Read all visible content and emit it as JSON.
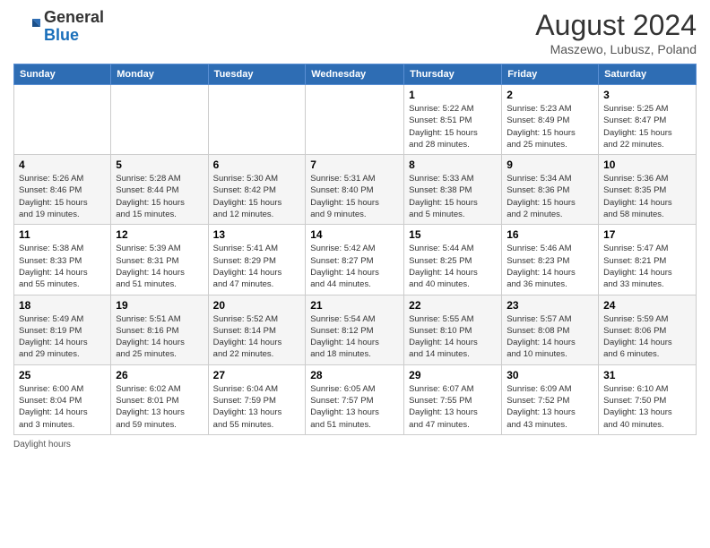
{
  "header": {
    "logo_general": "General",
    "logo_blue": "Blue",
    "month_year": "August 2024",
    "location": "Maszewo, Lubusz, Poland"
  },
  "days_of_week": [
    "Sunday",
    "Monday",
    "Tuesday",
    "Wednesday",
    "Thursday",
    "Friday",
    "Saturday"
  ],
  "weeks": [
    [
      {
        "num": "",
        "info": ""
      },
      {
        "num": "",
        "info": ""
      },
      {
        "num": "",
        "info": ""
      },
      {
        "num": "",
        "info": ""
      },
      {
        "num": "1",
        "info": "Sunrise: 5:22 AM\nSunset: 8:51 PM\nDaylight: 15 hours\nand 28 minutes."
      },
      {
        "num": "2",
        "info": "Sunrise: 5:23 AM\nSunset: 8:49 PM\nDaylight: 15 hours\nand 25 minutes."
      },
      {
        "num": "3",
        "info": "Sunrise: 5:25 AM\nSunset: 8:47 PM\nDaylight: 15 hours\nand 22 minutes."
      }
    ],
    [
      {
        "num": "4",
        "info": "Sunrise: 5:26 AM\nSunset: 8:46 PM\nDaylight: 15 hours\nand 19 minutes."
      },
      {
        "num": "5",
        "info": "Sunrise: 5:28 AM\nSunset: 8:44 PM\nDaylight: 15 hours\nand 15 minutes."
      },
      {
        "num": "6",
        "info": "Sunrise: 5:30 AM\nSunset: 8:42 PM\nDaylight: 15 hours\nand 12 minutes."
      },
      {
        "num": "7",
        "info": "Sunrise: 5:31 AM\nSunset: 8:40 PM\nDaylight: 15 hours\nand 9 minutes."
      },
      {
        "num": "8",
        "info": "Sunrise: 5:33 AM\nSunset: 8:38 PM\nDaylight: 15 hours\nand 5 minutes."
      },
      {
        "num": "9",
        "info": "Sunrise: 5:34 AM\nSunset: 8:36 PM\nDaylight: 15 hours\nand 2 minutes."
      },
      {
        "num": "10",
        "info": "Sunrise: 5:36 AM\nSunset: 8:35 PM\nDaylight: 14 hours\nand 58 minutes."
      }
    ],
    [
      {
        "num": "11",
        "info": "Sunrise: 5:38 AM\nSunset: 8:33 PM\nDaylight: 14 hours\nand 55 minutes."
      },
      {
        "num": "12",
        "info": "Sunrise: 5:39 AM\nSunset: 8:31 PM\nDaylight: 14 hours\nand 51 minutes."
      },
      {
        "num": "13",
        "info": "Sunrise: 5:41 AM\nSunset: 8:29 PM\nDaylight: 14 hours\nand 47 minutes."
      },
      {
        "num": "14",
        "info": "Sunrise: 5:42 AM\nSunset: 8:27 PM\nDaylight: 14 hours\nand 44 minutes."
      },
      {
        "num": "15",
        "info": "Sunrise: 5:44 AM\nSunset: 8:25 PM\nDaylight: 14 hours\nand 40 minutes."
      },
      {
        "num": "16",
        "info": "Sunrise: 5:46 AM\nSunset: 8:23 PM\nDaylight: 14 hours\nand 36 minutes."
      },
      {
        "num": "17",
        "info": "Sunrise: 5:47 AM\nSunset: 8:21 PM\nDaylight: 14 hours\nand 33 minutes."
      }
    ],
    [
      {
        "num": "18",
        "info": "Sunrise: 5:49 AM\nSunset: 8:19 PM\nDaylight: 14 hours\nand 29 minutes."
      },
      {
        "num": "19",
        "info": "Sunrise: 5:51 AM\nSunset: 8:16 PM\nDaylight: 14 hours\nand 25 minutes."
      },
      {
        "num": "20",
        "info": "Sunrise: 5:52 AM\nSunset: 8:14 PM\nDaylight: 14 hours\nand 22 minutes."
      },
      {
        "num": "21",
        "info": "Sunrise: 5:54 AM\nSunset: 8:12 PM\nDaylight: 14 hours\nand 18 minutes."
      },
      {
        "num": "22",
        "info": "Sunrise: 5:55 AM\nSunset: 8:10 PM\nDaylight: 14 hours\nand 14 minutes."
      },
      {
        "num": "23",
        "info": "Sunrise: 5:57 AM\nSunset: 8:08 PM\nDaylight: 14 hours\nand 10 minutes."
      },
      {
        "num": "24",
        "info": "Sunrise: 5:59 AM\nSunset: 8:06 PM\nDaylight: 14 hours\nand 6 minutes."
      }
    ],
    [
      {
        "num": "25",
        "info": "Sunrise: 6:00 AM\nSunset: 8:04 PM\nDaylight: 14 hours\nand 3 minutes."
      },
      {
        "num": "26",
        "info": "Sunrise: 6:02 AM\nSunset: 8:01 PM\nDaylight: 13 hours\nand 59 minutes."
      },
      {
        "num": "27",
        "info": "Sunrise: 6:04 AM\nSunset: 7:59 PM\nDaylight: 13 hours\nand 55 minutes."
      },
      {
        "num": "28",
        "info": "Sunrise: 6:05 AM\nSunset: 7:57 PM\nDaylight: 13 hours\nand 51 minutes."
      },
      {
        "num": "29",
        "info": "Sunrise: 6:07 AM\nSunset: 7:55 PM\nDaylight: 13 hours\nand 47 minutes."
      },
      {
        "num": "30",
        "info": "Sunrise: 6:09 AM\nSunset: 7:52 PM\nDaylight: 13 hours\nand 43 minutes."
      },
      {
        "num": "31",
        "info": "Sunrise: 6:10 AM\nSunset: 7:50 PM\nDaylight: 13 hours\nand 40 minutes."
      }
    ]
  ],
  "footer": {
    "daylight_hours_label": "Daylight hours"
  }
}
